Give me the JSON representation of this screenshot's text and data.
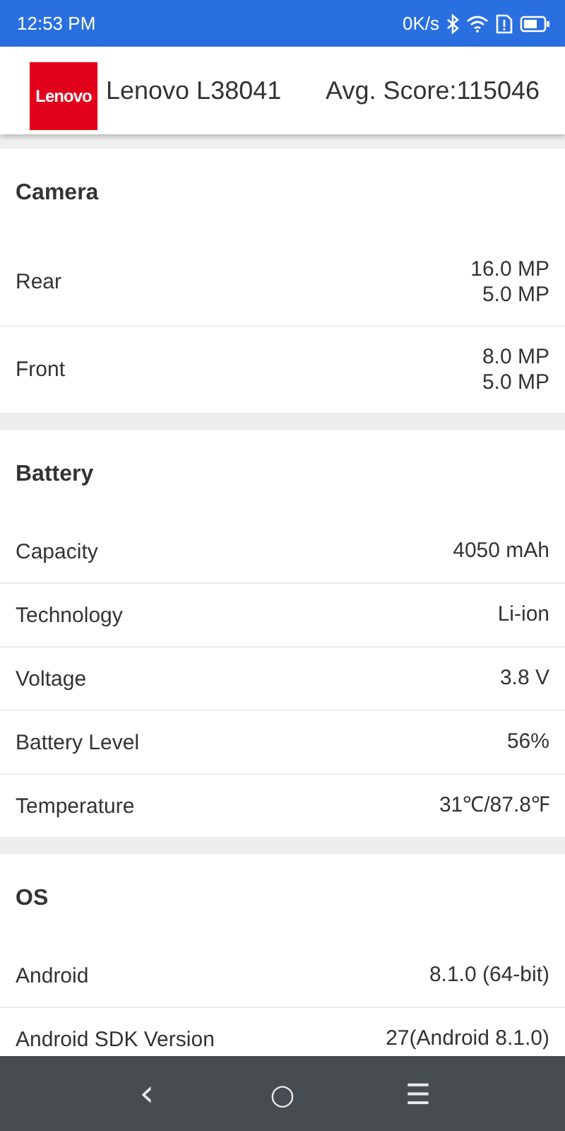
{
  "status_bar": {
    "time": "12:53 PM",
    "speed": "0K/s"
  },
  "header": {
    "logo": "Lenovo",
    "device": "Lenovo L38041",
    "score": "Avg. Score:115046"
  },
  "sections": [
    {
      "title": "Camera",
      "rows": [
        {
          "label": "Rear",
          "values": [
            "16.0 MP",
            "5.0 MP"
          ]
        },
        {
          "label": "Front",
          "values": [
            "8.0 MP",
            "5.0 MP"
          ]
        }
      ]
    },
    {
      "title": "Battery",
      "rows": [
        {
          "label": "Capacity",
          "values": [
            "4050 mAh"
          ]
        },
        {
          "label": "Technology",
          "values": [
            "Li-ion"
          ]
        },
        {
          "label": "Voltage",
          "values": [
            "3.8 V"
          ]
        },
        {
          "label": "Battery Level",
          "values": [
            "56%"
          ]
        },
        {
          "label": "Temperature",
          "values": [
            "31℃/87.8℉"
          ]
        }
      ]
    },
    {
      "title": "OS",
      "rows": [
        {
          "label": "Android",
          "values": [
            "8.1.0 (64-bit)"
          ]
        },
        {
          "label": "Android SDK Version",
          "values": [
            "27(Android 8.1.0)"
          ]
        }
      ]
    }
  ],
  "nav_bar": {
    "back": "‹",
    "home": "○",
    "recents": "☰"
  }
}
